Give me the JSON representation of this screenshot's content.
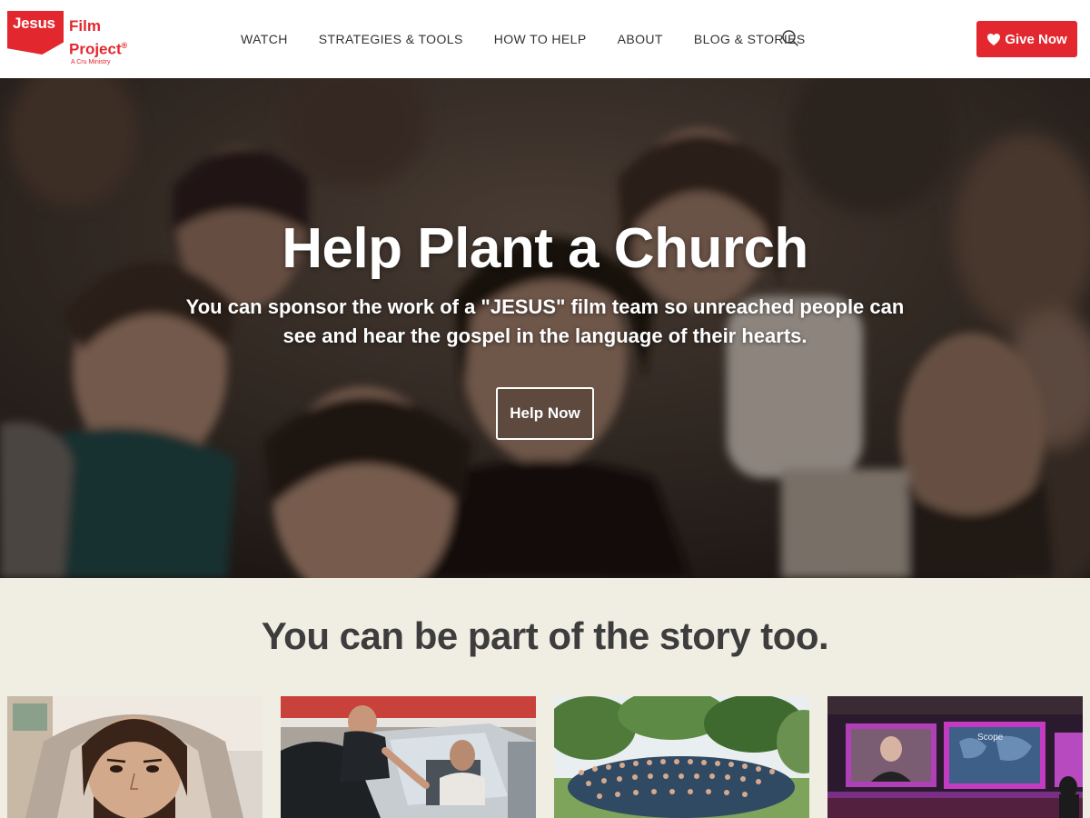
{
  "logo": {
    "box_text": "Jesus",
    "word_film": "Film",
    "word_project": "Project",
    "registered": "®",
    "tagline": "A Cru Ministry"
  },
  "nav": {
    "items": [
      "WATCH",
      "STRATEGIES & TOOLS",
      "HOW TO HELP",
      "ABOUT",
      "BLOG & STORIES"
    ],
    "search_icon": "search-icon"
  },
  "give_button": {
    "label": "Give Now",
    "icon": "heart-icon"
  },
  "hero": {
    "title": "Help Plant a Church",
    "subtitle": "You can sponsor the work of a \"JESUS\" film team so unreached people can see and hear the gospel in the language of their hearts.",
    "button_label": "Help Now"
  },
  "story": {
    "heading": "You can be part of the story too.",
    "cards": [
      {
        "image": "animated-jesus-image"
      },
      {
        "image": "car-conversation-image"
      },
      {
        "image": "group-photo-image"
      },
      {
        "image": "stage-presentation-image",
        "screen_text": "Scope"
      }
    ]
  },
  "colors": {
    "brand_red": "#e3272f",
    "section_bg": "#f0ede3",
    "header_bg": "#ffffff"
  }
}
